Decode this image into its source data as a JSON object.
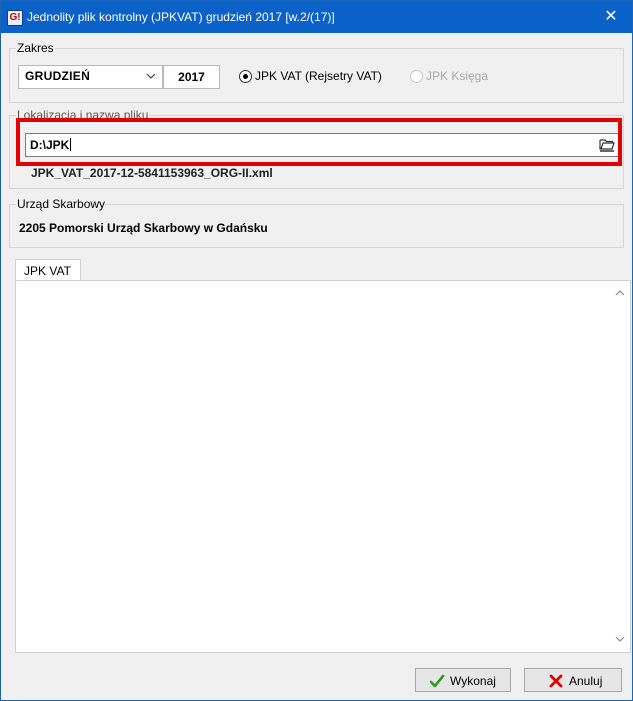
{
  "window": {
    "app_icon": "G!",
    "title": "Jednolity plik kontrolny (JPKVAT) grudzień 2017 [w.2/(17)]",
    "close_label": "✕"
  },
  "zakres": {
    "legend": "Zakres",
    "month": "GRUDZIEŃ",
    "year": "2017",
    "option_vat": "JPK VAT (Rejsetry VAT)",
    "option_ksiega": "JPK Księga",
    "selected": "JPK VAT (Rejsetry VAT)"
  },
  "file": {
    "legend": "Lokalizacja i nazwa pliku",
    "path": "D:\\JPK",
    "filename": "JPK_VAT_2017-12-5841153963_ORG-II.xml",
    "browse_icon": "folder-open-icon"
  },
  "office": {
    "legend": "Urząd Skarbowy",
    "name": "2205 Pomorski Urząd Skarbowy w Gdańsku"
  },
  "tabs": [
    {
      "label": "JPK VAT",
      "active": true
    }
  ],
  "buttons": {
    "execute": "Wykonaj",
    "cancel": "Anuluj"
  },
  "colors": {
    "title_bar": "#0a62c9",
    "highlight_frame": "#e00000",
    "ok_check": "#2e9a1f",
    "cancel_x": "#e00000"
  }
}
